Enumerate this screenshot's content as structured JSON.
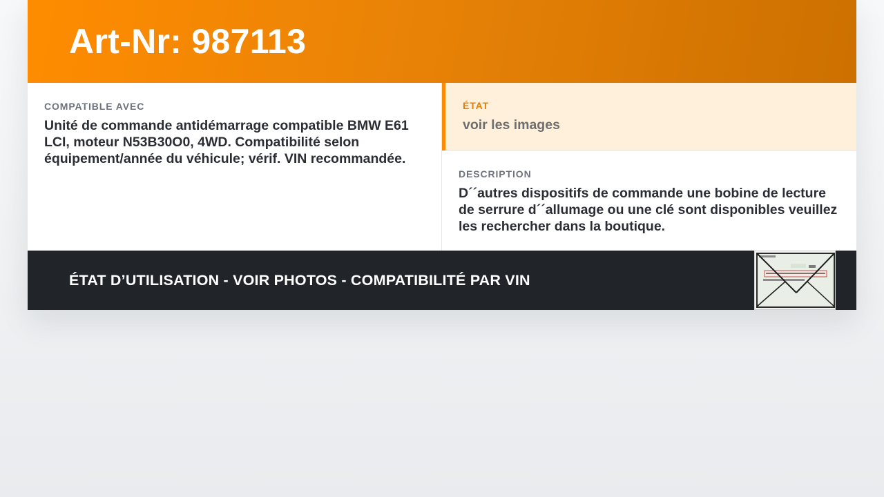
{
  "header": {
    "title": "Art-Nr: 987113"
  },
  "compat": {
    "label": "Compatible avec",
    "text": "Unité de commande antidémarrage compatible BMW E61 LCI, moteur N53B30O0, 4WD. Compatibilité selon équipement/année du véhicule; vérif. VIN recommandée."
  },
  "etat": {
    "label": "État",
    "value": "voir les images"
  },
  "description": {
    "label": "Description",
    "text": "D´´autres dispositifs de commande une bobine de lecture de serrure d´´allumage ou une clé sont disponibles veuillez les rechercher dans la boutique."
  },
  "footer": {
    "text": "ÉTAT D’UTILISATION - VOIR PHOTOS - COMPATIBILITÉ PAR VIN",
    "thumbnail_icon": "vin-document-thumbnail"
  },
  "colors": {
    "accent": "#ff8c00",
    "etat_background": "#fff0dc",
    "footer_background": "#212529"
  }
}
